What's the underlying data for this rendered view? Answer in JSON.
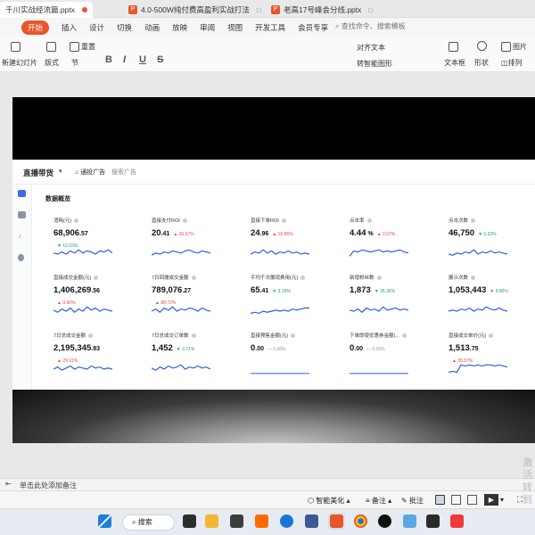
{
  "tabs": [
    {
      "label": "千川实战经流篇.pptx",
      "active": true
    },
    {
      "label": "4.0-500W纯付费高盈利实战打法",
      "active": false
    },
    {
      "label": "老高17号峰会分线.pptx",
      "active": false
    }
  ],
  "menu": [
    "开始",
    "插入",
    "设计",
    "切换",
    "动画",
    "放映",
    "审阅",
    "视图",
    "开发工具",
    "会员专享"
  ],
  "search_placeholder": "查找命令、搜索模板",
  "toolbar": {
    "new_slide": "新建幻灯片",
    "layout": "版式",
    "section": "节",
    "reset": "重置",
    "text_box": "文本框",
    "shape": "形状",
    "picture": "图片",
    "arrange": "排列",
    "align_text": "对齐文本",
    "smart_art": "转智能图形",
    "format_bold": "B",
    "format_italic": "I",
    "format_underline": "U",
    "format_strike": "S"
  },
  "dashboard": {
    "title": "直播带货",
    "ad_type": "通投广告",
    "search_ad": "搜索广告",
    "section": "数据概览",
    "metrics": [
      {
        "label": "消耗(元)",
        "int": "68,906",
        "dec": ".57",
        "change": "12.03%",
        "dir": "down",
        "spark": [
          6,
          5,
          7,
          5,
          8,
          6,
          9,
          6,
          8,
          7,
          5,
          8,
          7,
          9,
          6
        ]
      },
      {
        "label": "直接支付ROI",
        "int": "20",
        "dec": ".41",
        "change": "26.07%",
        "dir": "up",
        "spark": [
          4,
          6,
          5,
          7,
          6,
          8,
          7,
          6,
          8,
          9,
          7,
          6,
          8,
          7,
          6
        ]
      },
      {
        "label": "直接下单ROI",
        "int": "24",
        "dec": ".96",
        "change": "19.95%",
        "dir": "up",
        "spark": [
          5,
          7,
          6,
          9,
          6,
          8,
          5,
          7,
          6,
          8,
          6,
          7,
          5,
          6,
          5
        ]
      },
      {
        "label": "点击率",
        "int": "4.44",
        "dec": " %",
        "change": "2.07%",
        "dir": "up",
        "spark": [
          3,
          8,
          7,
          9,
          8,
          7,
          8,
          9,
          7,
          8,
          7,
          8,
          9,
          7,
          6
        ]
      },
      {
        "label": "点击次数",
        "int": "46,750",
        "dec": "",
        "change": "0.22%",
        "dir": "down",
        "spark": [
          5,
          4,
          6,
          5,
          7,
          6,
          9,
          5,
          7,
          6,
          8,
          6,
          7,
          6,
          5
        ]
      },
      {
        "label": "直接成交金额(元)",
        "int": "1,406,269",
        "dec": ".56",
        "change": "9.90%",
        "dir": "up",
        "spark": [
          6,
          4,
          7,
          5,
          8,
          4,
          7,
          5,
          9,
          6,
          8,
          5,
          7,
          6,
          5
        ]
      },
      {
        "label": "7日回搜成交金额",
        "int": "789,076",
        "dec": ".27",
        "change": "88.72%",
        "dir": "up",
        "spark": [
          5,
          7,
          4,
          8,
          6,
          9,
          5,
          7,
          6,
          8,
          7,
          5,
          8,
          6,
          5
        ]
      },
      {
        "label": "平均千次展现费用(元)",
        "int": "65",
        "dec": ".41",
        "change": "3.15%",
        "dir": "down",
        "spark": [
          3,
          4,
          3,
          5,
          4,
          5,
          6,
          5,
          6,
          5,
          7,
          6,
          7,
          8,
          8
        ]
      },
      {
        "label": "新增粉丝数",
        "int": "1,873",
        "dec": "",
        "change": "36.36%",
        "dir": "down",
        "spark": [
          6,
          5,
          7,
          4,
          8,
          6,
          7,
          5,
          9,
          6,
          7,
          8,
          6,
          7,
          6
        ]
      },
      {
        "label": "展示次数",
        "int": "1,053,443",
        "dec": "",
        "change": "9.90%",
        "dir": "down",
        "spark": [
          5,
          6,
          5,
          7,
          6,
          8,
          5,
          7,
          6,
          9,
          7,
          6,
          8,
          6,
          5
        ]
      },
      {
        "label": "7日总成交金额",
        "int": "2,195,345",
        "dec": ".83",
        "change": "29.31%",
        "dir": "up",
        "spark": [
          5,
          7,
          4,
          6,
          8,
          5,
          7,
          6,
          5,
          8,
          6,
          7,
          5,
          6,
          5
        ]
      },
      {
        "label": "7日总成交订单数",
        "int": "1,452",
        "dec": "",
        "change": "3.71%",
        "dir": "down",
        "spark": [
          6,
          4,
          7,
          5,
          8,
          6,
          7,
          9,
          5,
          7,
          6,
          8,
          6,
          7,
          5
        ]
      },
      {
        "label": "直接预售金额(元)",
        "int": "0",
        "dec": ".00",
        "change": "0.00%",
        "dir": "flat",
        "spark": [
          1,
          1,
          1,
          1,
          1,
          1,
          1,
          1,
          1,
          1,
          1,
          1,
          1,
          1,
          1
        ]
      },
      {
        "label": "下单即使优惠券金额(...",
        "int": "0",
        "dec": ".00",
        "change": "0.00%",
        "dir": "flat",
        "spark": [
          1,
          1,
          1,
          1,
          1,
          1,
          1,
          1,
          1,
          1,
          1,
          1,
          1,
          1,
          1
        ]
      },
      {
        "label": "直接成交单价(元)",
        "int": "1,513",
        "dec": ".75",
        "change": "35.57%",
        "dir": "up",
        "spark": [
          2,
          3,
          2,
          9,
          8,
          9,
          8,
          9,
          8,
          9,
          9,
          8,
          9,
          8,
          7
        ]
      }
    ]
  },
  "notes_placeholder": "单击此处添加备注",
  "status": {
    "beautify": "智能美化",
    "notes": "备注",
    "comment": "批注"
  },
  "taskbar": {
    "search": "搜索"
  },
  "watermark": "激活\n转到"
}
